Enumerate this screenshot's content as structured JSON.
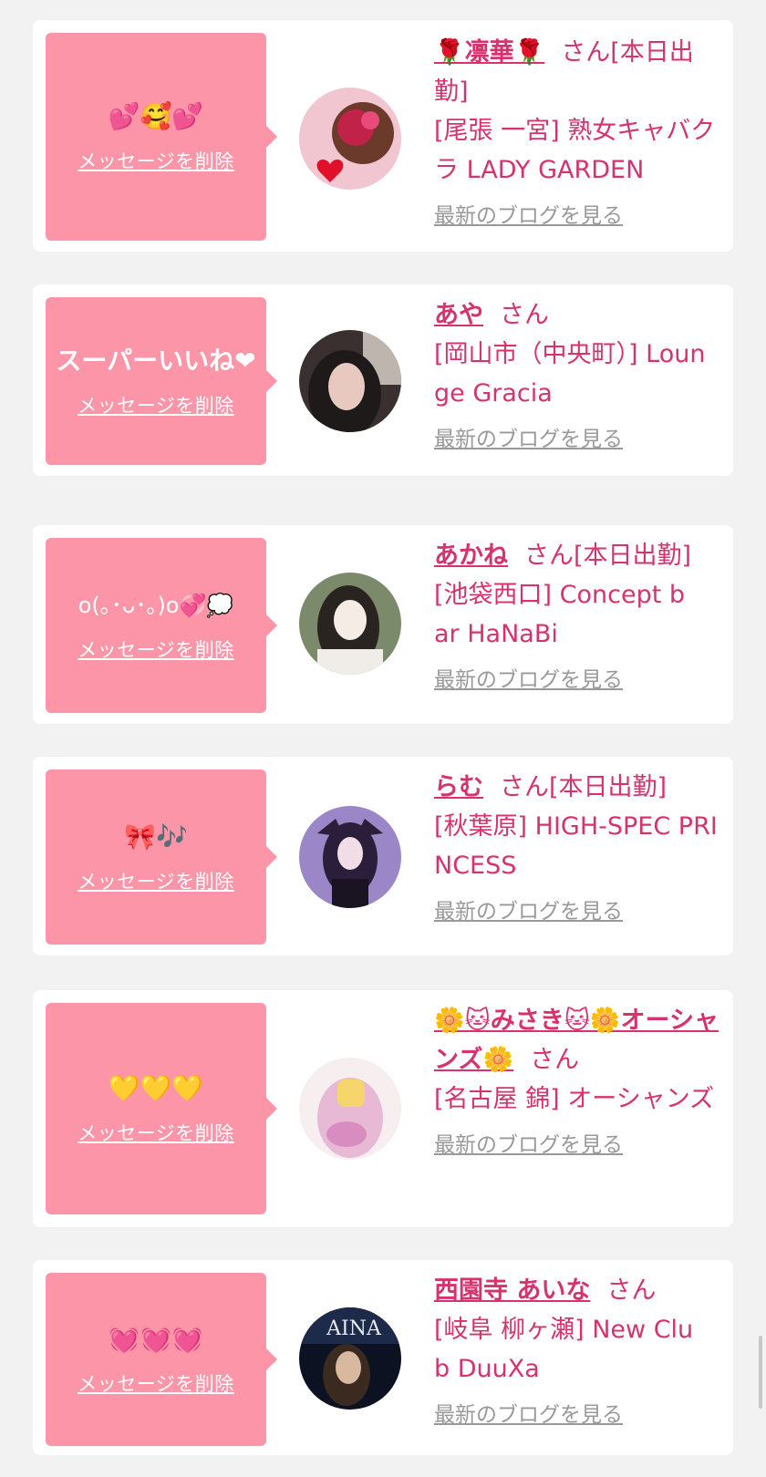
{
  "items": [
    {
      "message": "💕🥰💕",
      "delete_label": "メッセージを削除",
      "name": "🌹凛華🌹",
      "san": "さん",
      "status": "[本日出勤]",
      "shop": "[尾張 一宮] 熟女キャバクラ LADY GARDEN",
      "blog_label": "最新のブログを見る",
      "avatar_colors": [
        "#f1c6d1",
        "#c12247",
        "#6b3a2a"
      ]
    },
    {
      "message": "スーパーいいね❤",
      "delete_label": "メッセージを削除",
      "name": "あや",
      "san": "さん",
      "status": "",
      "shop": "[岡山市（中央町）] Lounge Gracia",
      "blog_label": "最新のブログを見る",
      "avatar_colors": [
        "#3a3030",
        "#e8c9c0",
        "#1e1a1a"
      ]
    },
    {
      "message": "o(｡･ᴗ･｡)o💞💭",
      "delete_label": "メッセージを削除",
      "name": "あかね",
      "san": "さん",
      "status": "[本日出勤]",
      "shop": "[池袋西口] Concept bar HaNaBi",
      "blog_label": "最新のブログを見る",
      "avatar_colors": [
        "#7a8a6a",
        "#f5ece6",
        "#2a2420"
      ]
    },
    {
      "message": "🎀🎶",
      "delete_label": "メッセージを削除",
      "name": "らむ",
      "san": "さん",
      "status": "[本日出勤]",
      "shop": "[秋葉原] HIGH-SPEC PRINCESS",
      "blog_label": "最新のブログを見る",
      "avatar_colors": [
        "#9b86c8",
        "#2a1e3a",
        "#f0dde6"
      ]
    },
    {
      "message": "💛💛💛",
      "delete_label": "メッセージを削除",
      "name": "🌼🐱みさき🐱🌼オーシャンズ🌼",
      "san": "さん",
      "status": "",
      "shop": "[名古屋 錦] オーシャンズ",
      "blog_label": "最新のブログを見る",
      "avatar_colors": [
        "#f7eef0",
        "#e7b9d4",
        "#f6d56d"
      ]
    },
    {
      "message": "💓💓💓",
      "delete_label": "メッセージを削除",
      "name": "西園寺 あいな",
      "san": "さん",
      "status": "",
      "shop": "[岐阜 柳ヶ瀬] New Club DuuXa",
      "blog_label": "最新のブログを見る",
      "avatar_colors": [
        "#1e2a4a",
        "#d8b9a0",
        "#0c1222"
      ],
      "avatar_text": "AINA"
    }
  ]
}
